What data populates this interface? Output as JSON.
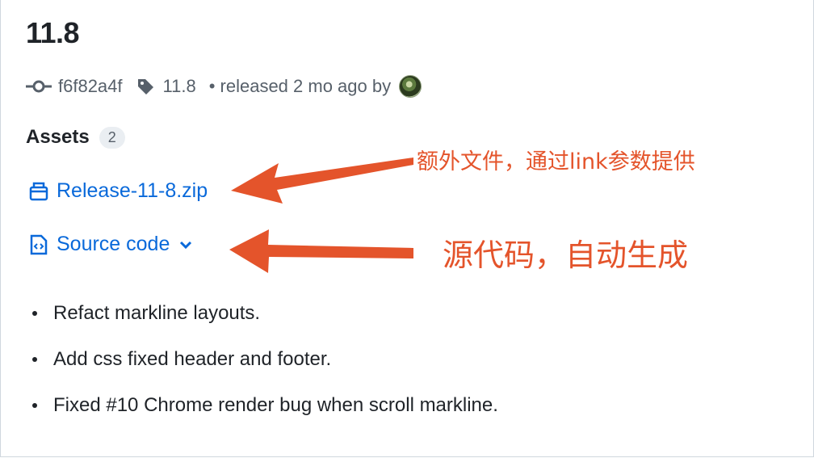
{
  "release": {
    "title": "11.8",
    "commit": "f6f82a4f",
    "tag": "11.8",
    "released_text": "• released 2 mo ago by"
  },
  "assets": {
    "label": "Assets",
    "count": "2",
    "items": [
      {
        "name": "Release-11-8.zip",
        "icon": "package-icon"
      },
      {
        "name": "Source code",
        "icon": "file-code-icon"
      }
    ]
  },
  "notes": [
    "Refact markline layouts.",
    "Add css fixed header and footer.",
    "Fixed #10 Chrome render bug when scroll markline."
  ],
  "annotations": {
    "extra_files": "额外文件，通过link参数提供",
    "source_code": "源代码，自动生成"
  },
  "colors": {
    "link": "#0969da",
    "annotation": "#e4542b",
    "muted": "#57606a"
  }
}
